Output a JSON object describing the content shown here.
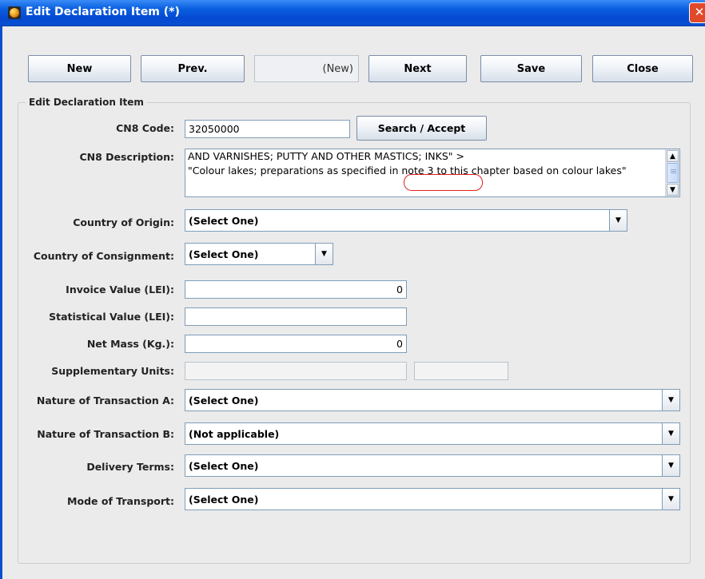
{
  "window": {
    "title": "Edit Declaration Item (*)",
    "close_glyph": "✕"
  },
  "toolbar": {
    "new_label": "New",
    "prev_label": "Prev.",
    "status": "(New)",
    "next_label": "Next",
    "save_label": "Save",
    "close_label": "Close"
  },
  "group_title": "Edit Declaration Item",
  "form": {
    "cn8_code": {
      "label": "CN8 Code:",
      "value": "32050000"
    },
    "search_label": "Search / Accept",
    "cn8_description": {
      "label": "CN8 Description:",
      "value": "AND VARNISHES; PUTTY AND OTHER MASTICS; INKS\" >\n\"Colour lakes; preparations as specified in note 3 to this chapter based on colour lakes\""
    },
    "country_of_origin": {
      "label": "Country of Origin:",
      "value": "(Select One)"
    },
    "country_of_consignment": {
      "label": "Country of Consignment:",
      "value": "(Select One)"
    },
    "invoice_value": {
      "label": "Invoice Value (LEI):",
      "value": "0"
    },
    "statistical_value": {
      "label": "Statistical Value (LEI):",
      "value": ""
    },
    "net_mass": {
      "label": "Net Mass (Kg.):",
      "value": "0"
    },
    "supplementary_units": {
      "label": "Supplementary Units:",
      "value": "",
      "unit": ""
    },
    "nature_transaction_a": {
      "label": "Nature of Transaction A:",
      "value": "(Select One)"
    },
    "nature_transaction_b": {
      "label": "Nature of Transaction B:",
      "value": "(Not applicable)"
    },
    "delivery_terms": {
      "label": "Delivery Terms:",
      "value": "(Select One)"
    },
    "mode_of_transport": {
      "label": "Mode of Transport:",
      "value": "(Select One)"
    }
  },
  "icons": {
    "combo_arrow": "▼",
    "scroll_up": "▲",
    "scroll_down": "▼"
  },
  "colors": {
    "title_bar": "#0a5fe0",
    "annotation_circle": "#e02020"
  }
}
